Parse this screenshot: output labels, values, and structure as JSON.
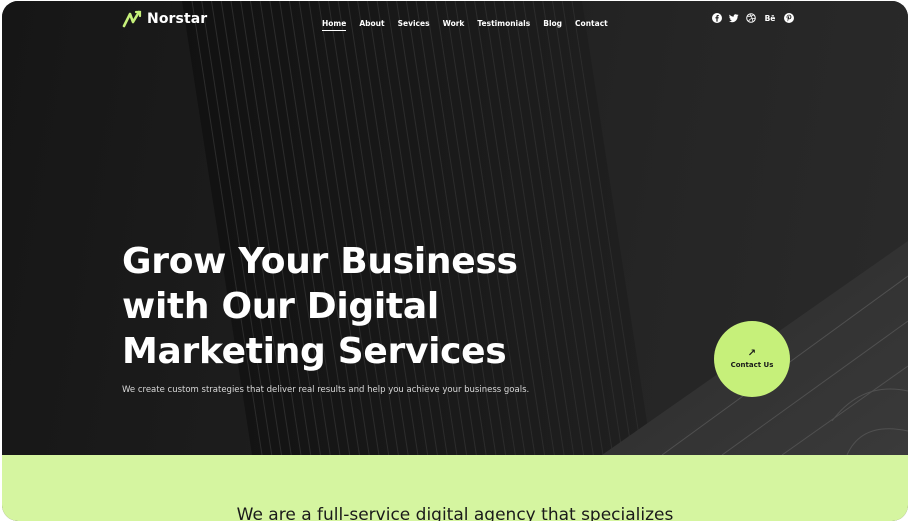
{
  "brand": {
    "name": "Norstar",
    "accent": "#c6f07a",
    "band_color": "#d5f5a0"
  },
  "nav": {
    "items": [
      {
        "label": "Home",
        "active": true
      },
      {
        "label": "About",
        "active": false
      },
      {
        "label": "Sevices",
        "active": false
      },
      {
        "label": "Work",
        "active": false
      },
      {
        "label": "Testimonials",
        "active": false
      },
      {
        "label": "Blog",
        "active": false
      },
      {
        "label": "Contact",
        "active": false
      }
    ]
  },
  "socials": [
    {
      "icon": "facebook-icon"
    },
    {
      "icon": "twitter-icon"
    },
    {
      "icon": "dribbble-icon"
    },
    {
      "icon": "behance-icon",
      "label": "Bē"
    },
    {
      "icon": "pinterest-icon"
    }
  ],
  "hero": {
    "headline_lines": [
      "Grow Your Business",
      "with Our Digital",
      "Marketing Services"
    ],
    "subtext": "We create custom strategies that deliver real results and help you achieve your business goals.",
    "cta_label": "Contact Us",
    "cta_icon": "arrow-up-right-icon"
  },
  "band": {
    "text": "We are a full-service digital agency that specializes"
  }
}
